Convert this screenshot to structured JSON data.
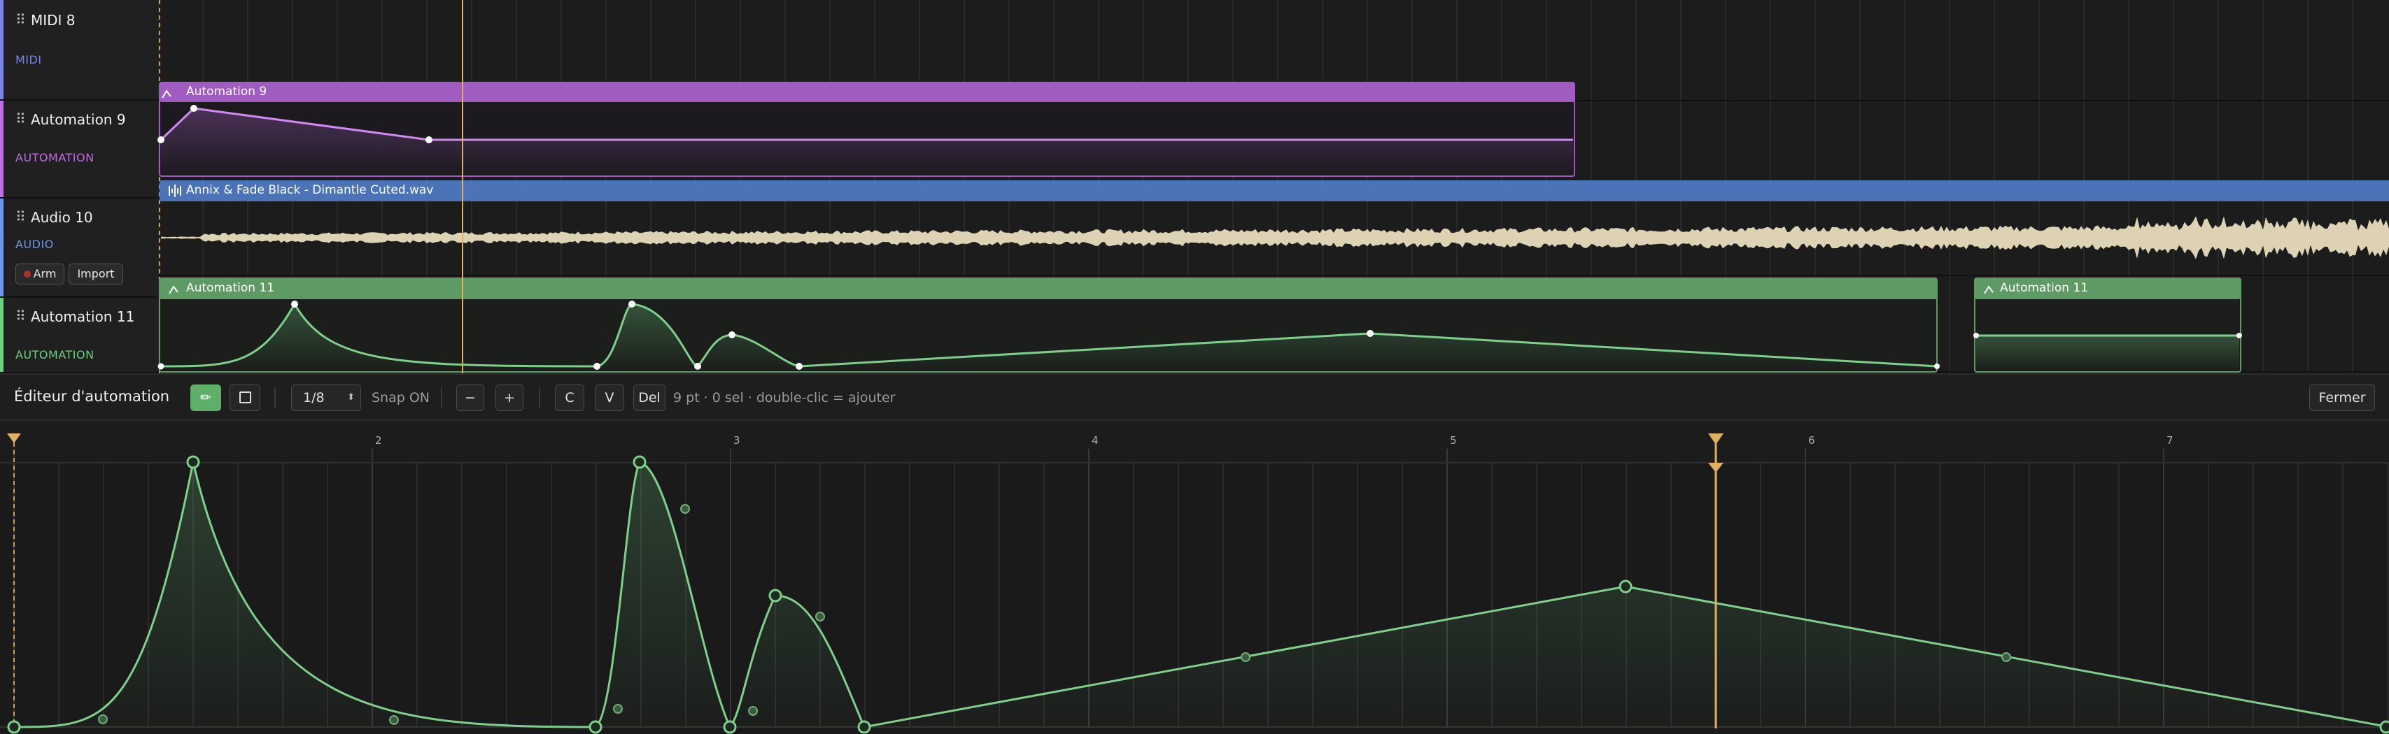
{
  "tracks": [
    {
      "name": "MIDI 8",
      "type": "MIDI",
      "color": "#7b84e0"
    },
    {
      "name": "Automation 9",
      "type": "AUTOMATION",
      "color": "#c070e0"
    },
    {
      "name": "Audio 10",
      "type": "AUDIO",
      "color": "#6e95e6"
    },
    {
      "name": "Automation 11",
      "type": "AUTOMATION",
      "color": "#6ecf82"
    }
  ],
  "audio_track": {
    "arm_label": "Arm",
    "import_label": "Import"
  },
  "clips": {
    "automation9": "Automation 9",
    "audio10": "Annix & Fade Black - Dimantle Cuted.wav",
    "automation11_a": "Automation 11",
    "automation11_b": "Automation 11"
  },
  "editor": {
    "title": "Éditeur d'automation",
    "pencil_icon": "pencil-icon",
    "select_icon": "square-select-icon",
    "grid_value": "1/8",
    "snap_label": "Snap ON",
    "minus_label": "−",
    "plus_label": "+",
    "copy_label": "C",
    "paste_label": "V",
    "delete_label": "Del",
    "status": "9 pt · 0 sel · double-clic = ajouter",
    "close_label": "Fermer"
  },
  "ruler": {
    "bars": [
      "2",
      "3",
      "4",
      "5",
      "6",
      "7"
    ]
  },
  "colors": {
    "purple": "#a05cc0",
    "blue": "#4a73b8",
    "green": "#5e9a64",
    "curve_green": "#7fcf8c",
    "playhead": "#e0b060",
    "waveform": "#ddd2b4"
  }
}
